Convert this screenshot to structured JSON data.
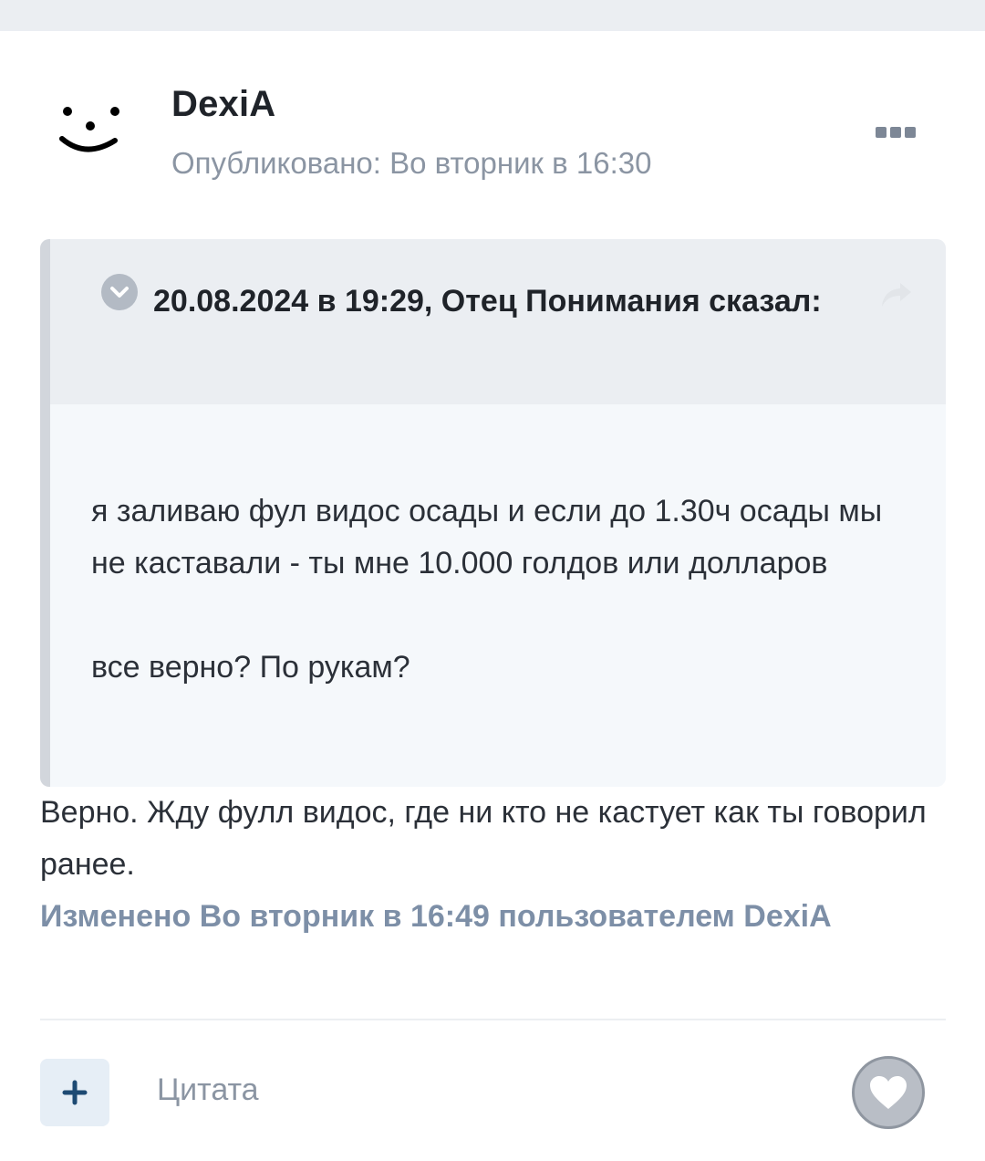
{
  "post": {
    "author": "DexiA",
    "published": "Опубликовано: Во вторник в 16:30",
    "avatar_icon": "smiley-face-icon",
    "menu_icon": "more-options-icon"
  },
  "quote": {
    "header": "20.08.2024 в 19:29, Отец Понимания сказал:",
    "toggle_icon": "chevron-down-icon",
    "share_icon": "share-arrow-icon",
    "paragraphs": [
      "я заливаю фул видос осады и если до 1.30ч осады мы не каставали - ты мне 10.000 голдов или долларов",
      "все верно? По рукам?"
    ]
  },
  "reply": {
    "text": "Верно.  Жду фулл видос, где ни кто не кастует как ты говорил ранее.",
    "edited": "Изменено Во вторник в 16:49 пользователем DexiA"
  },
  "footer": {
    "add_quote_icon": "plus-icon",
    "quote_label": "Цитата",
    "like_icon": "heart-icon"
  },
  "colors": {
    "accent": "#7d8fa7",
    "quote_bg": "#f5f8fb",
    "quote_header_bg": "#ebeef2"
  }
}
